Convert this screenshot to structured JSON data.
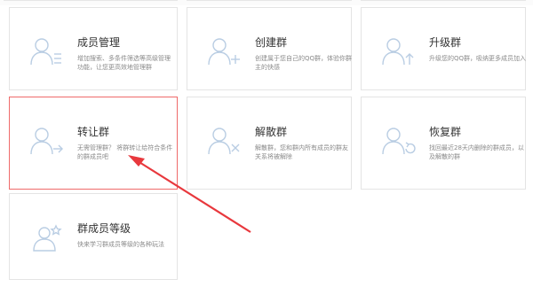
{
  "cards": [
    {
      "title": "成员管理",
      "desc": "增加搜索、多条件筛选等高级管理功能，让您更高效地管理群",
      "icon": "member-manage-icon"
    },
    {
      "title": "创建群",
      "desc": "创建属于您自己的QQ群，体验你群主的快感",
      "icon": "create-group-icon"
    },
    {
      "title": "升级群",
      "desc": "升级您的QQ群，吸纳更多成员加入",
      "icon": "upgrade-group-icon"
    },
    {
      "title": "转让群",
      "desc": "无需管理群？ 将群转让给符合条件的群成员吧",
      "icon": "transfer-group-icon"
    },
    {
      "title": "解散群",
      "desc": "解散群，您和群内所有成员的群友关系将被解除",
      "icon": "dismiss-group-icon"
    },
    {
      "title": "恢复群",
      "desc": "找回最近28天内删除的群成员，以及解散的群",
      "icon": "restore-group-icon"
    },
    {
      "title": "群成员等级",
      "desc": "快来学习群成员等级的各种玩法",
      "icon": "member-level-icon"
    }
  ],
  "colors": {
    "highlight": "#ef6a6a",
    "arrow": "#e8383d"
  }
}
